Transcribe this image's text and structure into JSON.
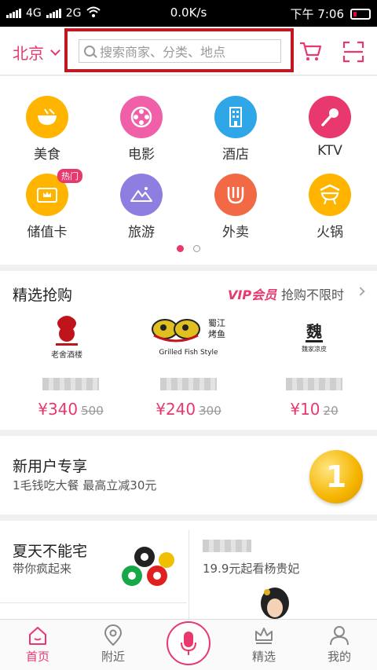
{
  "status_bar": {
    "network_1": "4G",
    "network_2": "2G",
    "speed": "0.0K/s",
    "time": "下午 7:06"
  },
  "header": {
    "city": "北京",
    "search_placeholder": "搜索商家、分类、地点"
  },
  "categories": [
    {
      "label": "美食",
      "icon": "bowl-icon",
      "color": "#ffb400"
    },
    {
      "label": "电影",
      "icon": "film-reel-icon",
      "color": "#f060a8"
    },
    {
      "label": "酒店",
      "icon": "hotel-icon",
      "color": "#2ea6e8"
    },
    {
      "label": "KTV",
      "icon": "microphone-icon",
      "color": "#e8386d"
    },
    {
      "label": "储值卡",
      "icon": "crown-card-icon",
      "color": "#ffb400",
      "badge": "热门"
    },
    {
      "label": "旅游",
      "icon": "mountain-icon",
      "color": "#8e7ee0"
    },
    {
      "label": "外卖",
      "icon": "fork-icon",
      "color": "#f26a45"
    },
    {
      "label": "火锅",
      "icon": "hotpot-icon",
      "color": "#ffb400"
    }
  ],
  "flash_sale": {
    "title": "精选抢购",
    "vip_label": "VIP会员",
    "more_label": "抢购不限时",
    "deals": [
      {
        "price": "¥340",
        "original": "500",
        "logo": "老舍酒楼 restaurant logo"
      },
      {
        "price": "¥240",
        "original": "300",
        "logo_text": "Grilled Fish Style"
      },
      {
        "price": "¥10",
        "original": "20",
        "logo": "魏家凉皮 logo"
      }
    ]
  },
  "new_user": {
    "title": "新用户专享",
    "subtitle": "1毛钱吃大餐 最高立减30元",
    "coin_number": "1"
  },
  "promos": {
    "left_title": "夏天不能宅",
    "left_subtitle": "带你疯起来",
    "right_subtitle": "19.9元起看杨贵妃"
  },
  "tabbar": {
    "items": [
      {
        "label": "首页",
        "icon": "home-icon",
        "active": true
      },
      {
        "label": "附近",
        "icon": "location-pin-icon",
        "active": false
      },
      {
        "label": "精选",
        "icon": "crown-icon",
        "active": false
      },
      {
        "label": "我的",
        "icon": "user-icon",
        "active": false
      }
    ]
  },
  "colors": {
    "accent": "#e8386d",
    "annotation_red": "#c01820"
  }
}
